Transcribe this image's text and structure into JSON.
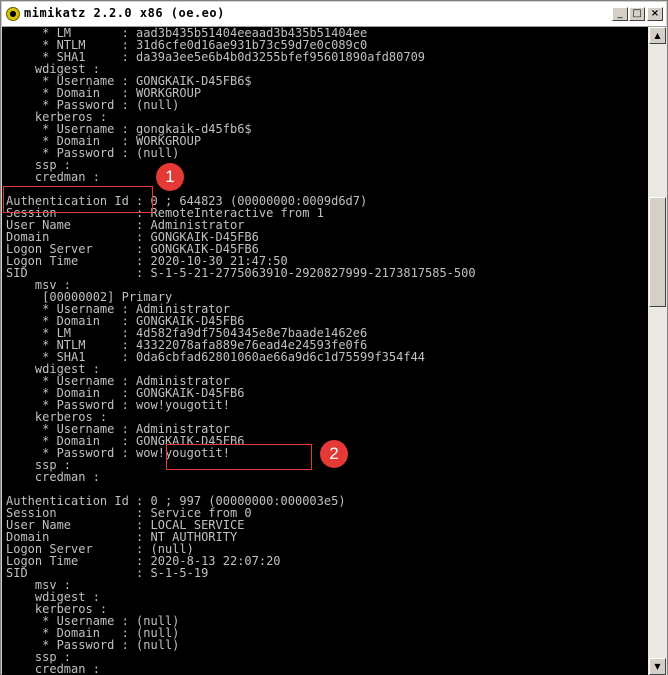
{
  "window": {
    "title": "mimikatz 2.2.0 x86 (oe.eo)",
    "minimize_glyph": "_",
    "maximize_glyph": "□",
    "close_glyph": "×"
  },
  "console_lines": [
    "     * LM       : aad3b435b51404eeaad3b435b51404ee",
    "     * NTLM     : 31d6cfe0d16ae931b73c59d7e0c089c0",
    "     * SHA1     : da39a3ee5e6b4b0d3255bfef95601890afd80709",
    "    wdigest :",
    "     * Username : GONGKAIK-D45FB6$",
    "     * Domain   : WORKGROUP",
    "     * Password : (null)",
    "    kerberos :",
    "     * Username : gongkaik-d45fb6$",
    "     * Domain   : WORKGROUP",
    "     * Password : (null)",
    "    ssp :",
    "    credman :",
    "",
    "Authentication Id : 0 ; 644823 (00000000:0009d6d7)",
    "Session           : RemoteInteractive from 1",
    "User Name         : Administrator",
    "Domain            : GONGKAIK-D45FB6",
    "Logon Server      : GONGKAIK-D45FB6",
    "Logon Time        : 2020-10-30 21:47:50",
    "SID               : S-1-5-21-2775063910-2920827999-2173817585-500",
    "    msv :",
    "     [00000002] Primary",
    "     * Username : Administrator",
    "     * Domain   : GONGKAIK-D45FB6",
    "     * LM       : 4d582fa9df7504345e8e7baade1462e6",
    "     * NTLM     : 43322078afa889e76ead4e24593fe0f6",
    "     * SHA1     : 0da6cbfad62801060ae66a9d6c1d75599f354f44",
    "    wdigest :",
    "     * Username : Administrator",
    "     * Domain   : GONGKAIK-D45FB6",
    "     * Password : wow!yougotit!",
    "    kerberos :",
    "     * Username : Administrator",
    "     * Domain   : GONGKAIK-D45FB6",
    "     * Password : wow!yougotit!",
    "    ssp :",
    "    credman :",
    "",
    "Authentication Id : 0 ; 997 (00000000:000003e5)",
    "Session           : Service from 0",
    "User Name         : LOCAL SERVICE",
    "Domain            : NT AUTHORITY",
    "Logon Server      : (null)",
    "Logon Time        : 2020-8-13 22:07:20",
    "SID               : S-1-5-19",
    "    msv :",
    "    wdigest :",
    "    kerberos :",
    "     * Username : (null)",
    "     * Domain   : (null)",
    "     * Password : (null)",
    "    ssp :",
    "    credman :"
  ],
  "annotations": [
    {
      "label": "1"
    },
    {
      "label": "2"
    }
  ],
  "scrollbar": {
    "up_glyph": "▲",
    "down_glyph": "▼"
  },
  "colors": {
    "console_bg": "#000000",
    "console_text": "#c0c0c0",
    "annotation_red": "#e53935"
  }
}
